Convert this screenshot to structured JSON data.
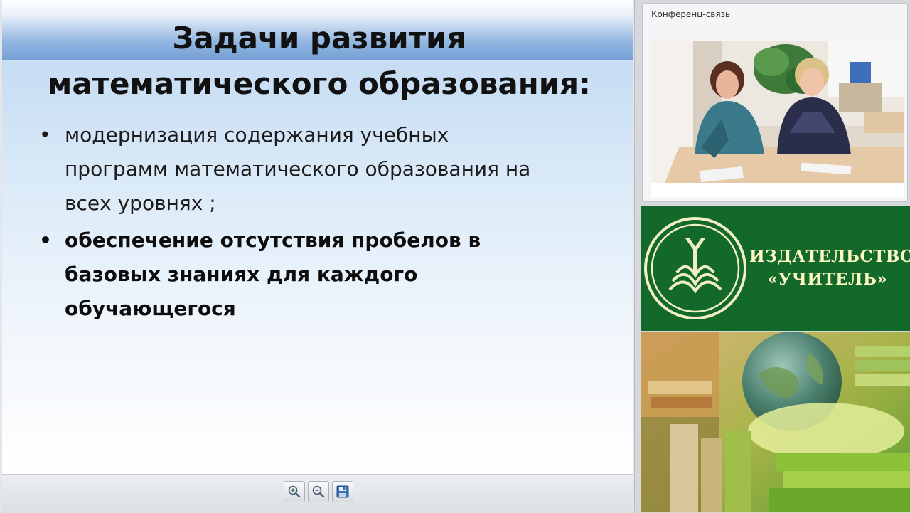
{
  "slide": {
    "title_line1": "Задачи развития",
    "title_line2": "математического образования:",
    "bullets": [
      {
        "bullet": "•",
        "lines": [
          "модернизация содержания учебных",
          "программ математического образования на",
          "всех уровнях ;"
        ]
      },
      {
        "bullet": "•",
        "lines": [
          "обеспечение отсутствия пробелов в",
          "базовых знаниях для каждого",
          "обучающегося"
        ]
      }
    ]
  },
  "toolbar": {
    "zoom_in_icon": "zoom-in-icon",
    "zoom_out_icon": "zoom-out-icon",
    "save_icon": "save-icon"
  },
  "conference": {
    "title": "Конференц-связь"
  },
  "publisher": {
    "line1": "ИЗДАТЕЛЬСТВО",
    "line2": "«УЧИТЕЛЬ»"
  },
  "colors": {
    "publisher_green": "#12692a",
    "publisher_text": "#fff7c2",
    "slide_band_blue": "#75a0d6"
  }
}
